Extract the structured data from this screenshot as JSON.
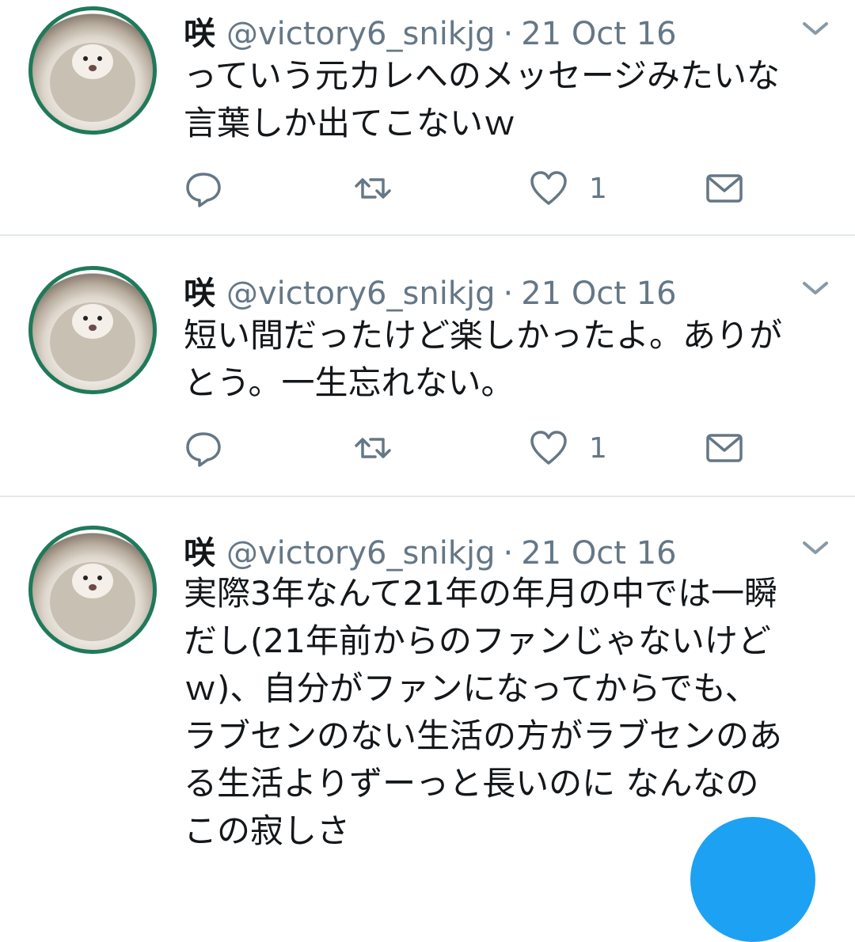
{
  "tweets": [
    {
      "name": "咲",
      "handle": "@victory6_snikjg",
      "separator": "·",
      "date": "21 Oct 16",
      "lines": [
        "っていう元カレへのメッセージみたいな",
        "言葉しか出てこないｗ"
      ],
      "like_count": "1"
    },
    {
      "name": "咲",
      "handle": "@victory6_snikjg",
      "separator": "·",
      "date": "21 Oct 16",
      "lines": [
        "短い間だったけど楽しかったよ。ありが",
        "とう。一生忘れない。"
      ],
      "like_count": "1"
    },
    {
      "name": "咲",
      "handle": "@victory6_snikjg",
      "separator": "·",
      "date": "21 Oct 16",
      "lines": [
        "実際3年なんて21年の年月の中では一瞬",
        "だし(21年前からのファンじゃないけど",
        "ｗ)、自分がファンになってからでも、",
        "ラブセンのない生活の方がラブセンのあ",
        "る生活よりずーっと長いのに なんなの",
        "この寂しさ"
      ],
      "like_count": ""
    }
  ],
  "icons": {
    "reply": "reply-icon",
    "retweet": "retweet-icon",
    "like": "heart-icon",
    "dm": "envelope-icon",
    "menu": "chevron-down-icon",
    "compose": "compose-fab"
  },
  "colors": {
    "text": "#14171a",
    "secondary": "#657786",
    "divider": "#e1e8ed",
    "accent": "#1da1f2"
  }
}
